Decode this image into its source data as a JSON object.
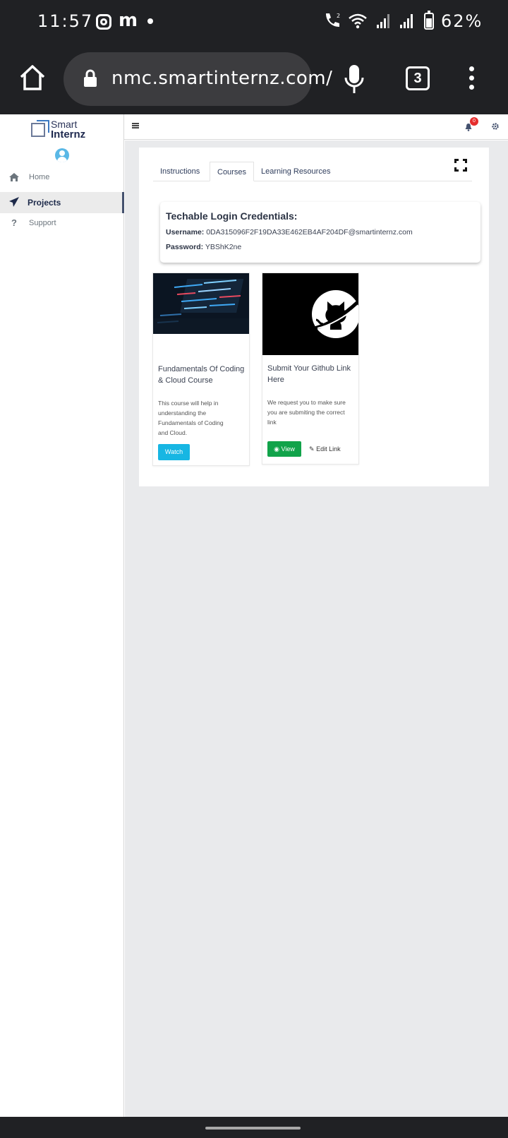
{
  "status_bar": {
    "time": "11:57",
    "notif_letter": "m",
    "battery": "62%",
    "icons": [
      "instagram-icon",
      "messenger-icon",
      "dot-icon",
      "wifi-call-icon",
      "wifi-icon",
      "signal-icon",
      "signal-icon",
      "battery-icon"
    ]
  },
  "browser": {
    "url": "nmc.smartinternz.com/",
    "tab_count": "3"
  },
  "sidebar": {
    "logo_line1": "Smart",
    "logo_line2": "Internz",
    "items": [
      {
        "label": "Home",
        "icon": "home-icon",
        "active": false
      },
      {
        "label": "Projects",
        "icon": "paper-plane-icon",
        "active": true
      },
      {
        "label": "Support",
        "icon": "question-icon",
        "active": false
      }
    ]
  },
  "topbar": {
    "notification_count": "0"
  },
  "tabs": [
    {
      "label": "Instructions",
      "active": false
    },
    {
      "label": "Courses",
      "active": true
    },
    {
      "label": "Learning Resources",
      "active": false
    }
  ],
  "credentials": {
    "title": "Techable Login Credentials:",
    "username_label": "Username:",
    "username": "0DA315096F2F19DA33E462EB4AF204DF@smartinternz.com",
    "password_label": "Password:",
    "password": "YBShK2ne"
  },
  "courses": [
    {
      "title": "Fundamentals Of Coding & Cloud Course",
      "description": "This course will help in understanding the Fundamentals of Coding and Cloud.",
      "button": "Watch"
    },
    {
      "title": "Submit Your Github Link Here",
      "description": "We request you to make sure you are submiting the correct link",
      "button": "View",
      "secondary": "Edit Link"
    }
  ],
  "colors": {
    "accent_cyan": "#17b6e3",
    "accent_green": "#11a34a",
    "sidebar_active": "#44516e",
    "badge_red": "#e52d2d"
  }
}
